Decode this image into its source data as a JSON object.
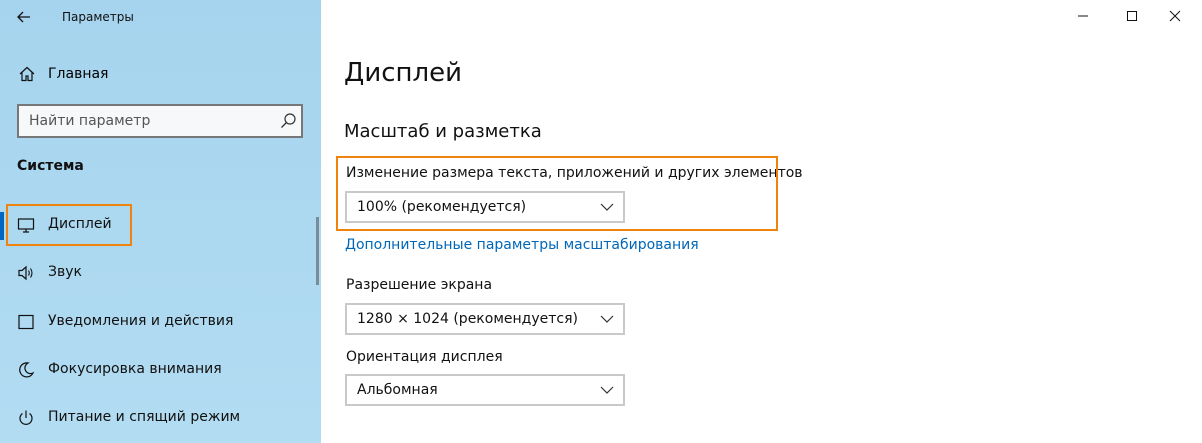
{
  "window": {
    "title": "Параметры"
  },
  "sidebar": {
    "home_label": "Главная",
    "search": {
      "placeholder": "Найти параметр",
      "value": ""
    },
    "section_title": "Система",
    "items": [
      {
        "label": "Дисплей",
        "icon": "monitor-icon",
        "selected": true
      },
      {
        "label": "Звук",
        "icon": "speaker-icon",
        "selected": false
      },
      {
        "label": "Уведомления и действия",
        "icon": "notification-icon",
        "selected": false
      },
      {
        "label": "Фокусировка внимания",
        "icon": "moon-icon",
        "selected": false
      },
      {
        "label": "Питание и спящий режим",
        "icon": "power-icon",
        "selected": false
      }
    ]
  },
  "main": {
    "page_title": "Дисплей",
    "scale_section": {
      "title": "Масштаб и разметка",
      "text_size_label": "Изменение размера текста, приложений и других элементов",
      "text_size_value": "100% (рекомендуется)",
      "advanced_link": "Дополнительные параметры масштабирования"
    },
    "resolution": {
      "label": "Разрешение экрана",
      "value": "1280 × 1024 (рекомендуется)"
    },
    "orientation": {
      "label": "Ориентация дисплея",
      "value": "Альбомная"
    }
  },
  "colors": {
    "sidebar_bg": "#a6d4ee",
    "accent": "#0067c0",
    "link": "#0067b8",
    "highlight": "#f0820e"
  }
}
